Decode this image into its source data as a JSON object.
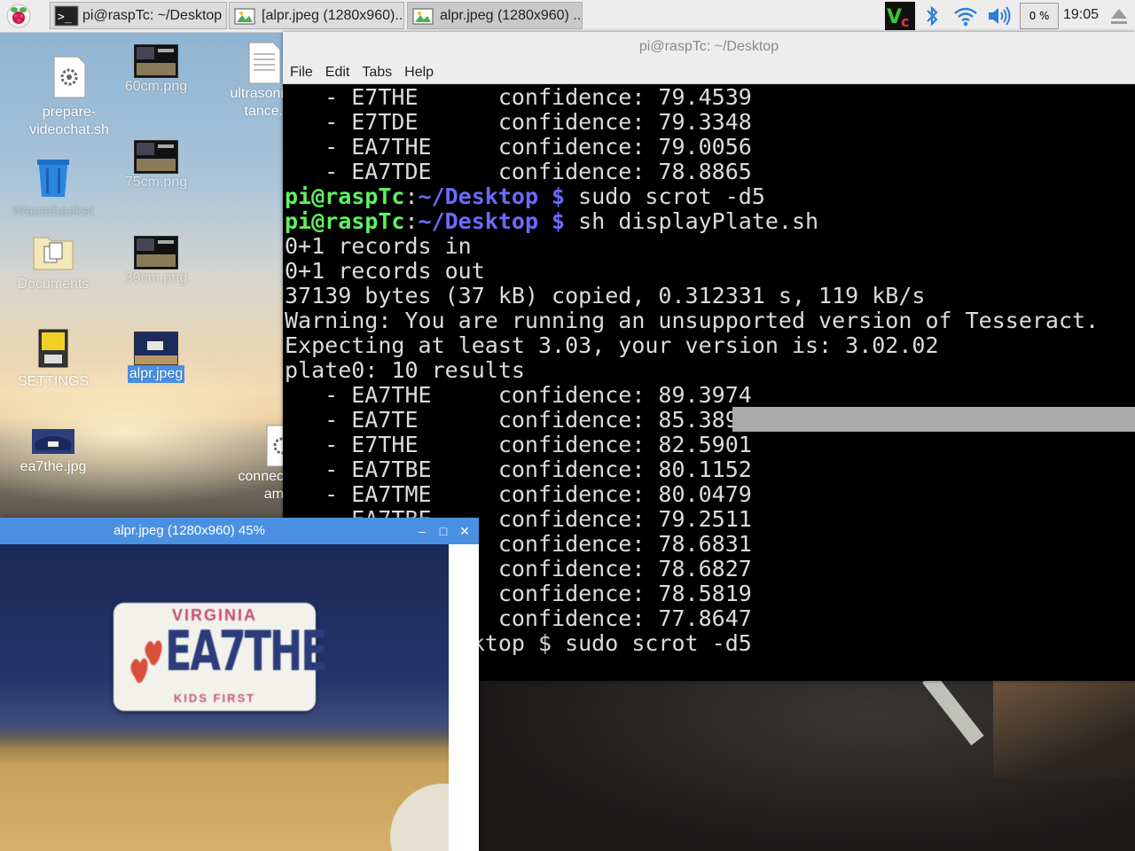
{
  "taskbar": {
    "tasks": [
      {
        "label": "pi@raspTc: ~/Desktop",
        "icon": "terminal-icon"
      },
      {
        "label": "[alpr.jpeg (1280x960)...",
        "icon": "image-icon"
      },
      {
        "label": "alpr.jpeg (1280x960) ...",
        "icon": "image-icon"
      }
    ],
    "tray": {
      "vnc_label": "V2",
      "cpu": "0 %",
      "clock": "19:05"
    }
  },
  "desktop": {
    "icons": [
      {
        "label": "prepare-\nvideochat.sh"
      },
      {
        "label": "60cm.png"
      },
      {
        "label": "ultrasonic\ntance.p"
      },
      {
        "label": "Wastebasket"
      },
      {
        "label": "75cm.png"
      },
      {
        "label": "Documents"
      },
      {
        "label": "30cm.png"
      },
      {
        "label": "SETTINGS"
      },
      {
        "label": "alpr.jpeg"
      },
      {
        "label": "ea7the.jpg"
      },
      {
        "label": "connec\nam"
      }
    ]
  },
  "terminal": {
    "title": "pi@raspTc: ~/Desktop",
    "menu": [
      "File",
      "Edit",
      "Tabs",
      "Help"
    ],
    "prompt_user": "pi@raspTc",
    "prompt_path": "~/Desktop $",
    "lines": [
      {
        "text": "   - E7THE      confidence: 79.4539"
      },
      {
        "text": "   - E7TDE      confidence: 79.3348"
      },
      {
        "text": "   - EA7THE     confidence: 79.0056"
      },
      {
        "text": "   - EA7TDE     confidence: 78.8865"
      },
      {
        "prompt": true,
        "cmd": " sudo scrot -d5"
      },
      {
        "prompt": true,
        "cmd": " sh displayPlate.sh"
      },
      {
        "text": "0+1 records in"
      },
      {
        "text": "0+1 records out"
      },
      {
        "text": "37139 bytes (37 kB) copied, 0.312331 s, 119 kB/s"
      },
      {
        "text": "Warning: You are running an unsupported version of Tesseract."
      },
      {
        "text": "Expecting at least 3.03, your version is: 3.02.02"
      },
      {
        "text": "plate0: 10 results"
      },
      {
        "text": "   - EA7THE     confidence: 89.3974"
      },
      {
        "text": "   - EA7TE      confidence: 85.3892"
      },
      {
        "text": "   - E7THE      confidence: 82.5901"
      },
      {
        "text": "   - EA7TBE     confidence: 80.1152"
      },
      {
        "text": "   - EA7TME     confidence: 80.0479"
      },
      {
        "text": "   - EA7TBE     confidence: 79.2511"
      },
      {
        "text": "                confidence: 78.6831"
      },
      {
        "text": "                confidence: 78.6827"
      },
      {
        "text": "                confidence: 78.5819"
      },
      {
        "text": "                confidence: 77.8647"
      },
      {
        "text": "              ktop $ sudo scrot -d5"
      }
    ]
  },
  "viewer": {
    "title": "alpr.jpeg (1280x960) 45%",
    "plate_state": "VIRGINIA",
    "plate_number": "EA7THE",
    "plate_slogan": "KIDS FIRST",
    "min_label": "–",
    "max_label": "□",
    "close_label": "✕"
  }
}
